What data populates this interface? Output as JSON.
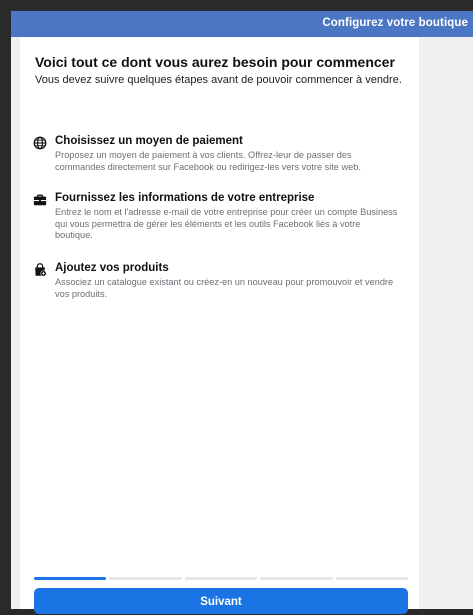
{
  "header": {
    "title": "Configurez votre boutique"
  },
  "intro": {
    "title": "Voici tout ce dont vous aurez besoin pour commencer",
    "subtitle": "Vous devez suivre quelques étapes avant de pouvoir commencer à vendre."
  },
  "steps": [
    {
      "icon": "globe-icon",
      "title": "Choisissez un moyen de paiement",
      "description": "Proposez un moyen de paiement à vos clients. Offrez-leur de passer des commandes directement sur Facebook ou redirigez-les vers votre site web."
    },
    {
      "icon": "briefcase-icon",
      "title": "Fournissez les informations de votre entreprise",
      "description": "Entrez le nom et l'adresse e-mail de votre entreprise pour créer un compte Business qui vous permettra de gérer les éléments et les outils Facebook liés à votre boutique."
    },
    {
      "icon": "shopping-bag-add-icon",
      "title": "Ajoutez vos produits",
      "description": "Associez un catalogue existant ou créez-en un nouveau pour promouvoir et vendre vos produits."
    }
  ],
  "progress": {
    "current_step": 1,
    "total_steps": 5
  },
  "footer": {
    "next_label": "Suivant"
  },
  "colors": {
    "topbar": "#4a76c4",
    "accent": "#1b74e4",
    "background": "#eff0f2"
  }
}
